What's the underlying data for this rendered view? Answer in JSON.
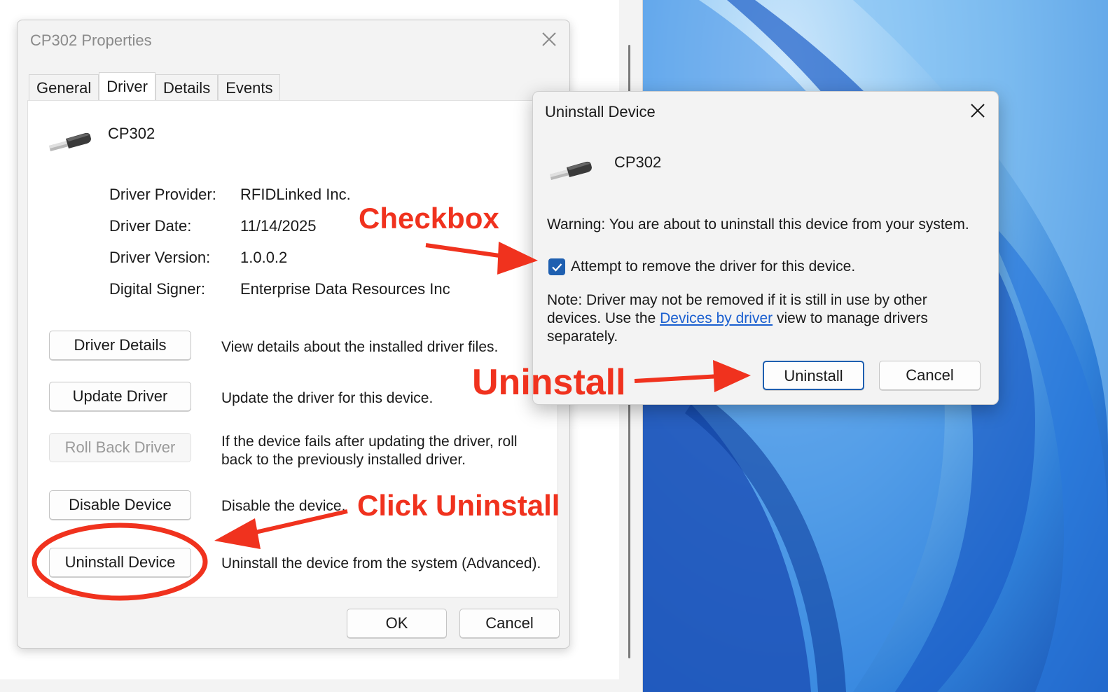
{
  "properties_dialog": {
    "title": "CP302 Properties",
    "tabs": [
      {
        "label": "General",
        "active": false
      },
      {
        "label": "Driver",
        "active": true
      },
      {
        "label": "Details",
        "active": false
      },
      {
        "label": "Events",
        "active": false
      }
    ],
    "device_name": "CP302",
    "info": [
      {
        "label": "Driver Provider:",
        "value": "RFIDLinked Inc."
      },
      {
        "label": "Driver Date:",
        "value": "11/14/2025"
      },
      {
        "label": "Driver Version:",
        "value": "1.0.0.2"
      },
      {
        "label": "Digital Signer:",
        "value": "Enterprise Data Resources Inc"
      }
    ],
    "actions": [
      {
        "button": "Driver Details",
        "description": "View details about the installed driver files.",
        "enabled": true
      },
      {
        "button": "Update Driver",
        "description": "Update the driver for this device.",
        "enabled": true
      },
      {
        "button": "Roll Back Driver",
        "description": "If the device fails after updating the driver, roll back to the previously installed driver.",
        "enabled": false
      },
      {
        "button": "Disable Device",
        "description": "Disable the device.",
        "enabled": true
      },
      {
        "button": "Uninstall Device",
        "description": "Uninstall the device from the system (Advanced).",
        "enabled": true
      }
    ],
    "ok_label": "OK",
    "cancel_label": "Cancel"
  },
  "uninstall_dialog": {
    "title": "Uninstall Device",
    "device_name": "CP302",
    "warning": "Warning: You are about to uninstall this device from your system.",
    "checkbox_label": "Attempt to remove the driver for this device.",
    "checkbox_checked": true,
    "note_prefix": "Note: Driver may not be removed if it is still in use by other devices. Use the ",
    "note_link": "Devices by driver",
    "note_suffix": " view to manage drivers separately.",
    "uninstall_label": "Uninstall",
    "cancel_label": "Cancel"
  },
  "annotations": {
    "checkbox": "Checkbox",
    "uninstall": "Uninstall",
    "click_uninstall": "Click Uninstall",
    "color": "#f0321e"
  },
  "icons": {
    "device": "usb-plug-icon",
    "close": "close-icon",
    "check": "checkmark-icon"
  }
}
